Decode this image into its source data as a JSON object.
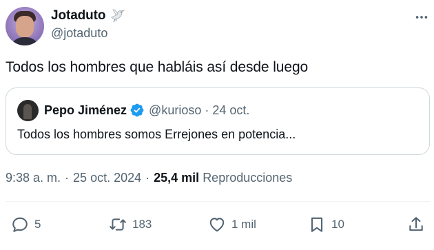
{
  "author": {
    "display_name": "Jotaduto",
    "handle": "@jotaduto",
    "badge_icon": "dove-icon"
  },
  "tweet": {
    "text": "Todos los hombres que habláis así desde luego"
  },
  "quoted": {
    "display_name": "Pepo Jiménez",
    "verified_icon": "verified-badge-icon",
    "handle": "@kurioso",
    "separator": "·",
    "time": "24 oct.",
    "text": "Todos los hombres somos Errejones en potencia..."
  },
  "meta": {
    "time": "9:38 a. m.",
    "separator1": "·",
    "date": "25 oct. 2024",
    "separator2": "·",
    "views_count": "25,4 mil",
    "views_label": "Reproducciones"
  },
  "actions": {
    "replies": "5",
    "reposts": "183",
    "likes": "1 mil",
    "bookmarks": "10"
  },
  "colors": {
    "text_primary": "#0f1419",
    "text_secondary": "#536471",
    "border": "#cfd9de",
    "divider": "#eff3f4",
    "verified_blue": "#1d9bf0"
  }
}
